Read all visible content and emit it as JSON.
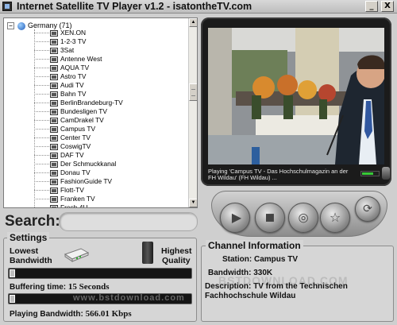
{
  "window": {
    "title": "Internet Satellite TV Player v1.2 - isatontheTV.com",
    "minimize_glyph": "_",
    "close_glyph": "X"
  },
  "tree": {
    "root_label": "Germany (71)",
    "expander": "−",
    "channels": [
      "XEN.ON",
      "1-2-3 TV",
      "3Sat",
      "Antenne West",
      "AQUA TV",
      "Astro TV",
      "Audi TV",
      "Bahn TV",
      "BerlinBrandeburg-TV",
      "Bundesligen TV",
      "CamDrakel TV",
      "Campus TV",
      "Center TV",
      "CoswigTV",
      "DAF TV",
      "Der Schmuckkanal",
      "Donau TV",
      "FashionGuide TV",
      "Flott-TV",
      "Franken TV",
      "Fresh 4U"
    ]
  },
  "player": {
    "now_playing": "Playing 'Campus TV - Das Hochschulmagazin an der",
    "now_playing_line2": "FH Wildau' (FH Wildau) ...",
    "signal_level": 0.65
  },
  "search": {
    "label": "Search:",
    "value": ""
  },
  "settings": {
    "title": "Settings",
    "lowest_label": "Lowest",
    "bandwidth_label": "Bandwidth",
    "highest_label": "Highest",
    "quality_label": "Quality",
    "bandwidth_slider_level": 0.0,
    "buffering_key": "Buffering time:",
    "buffering_value": "15 Seconds",
    "buffering_slider_level": 0.0,
    "playing_key": "Playing Bandwidth:",
    "playing_value": "566.01 Kbps"
  },
  "channel_info": {
    "title": "Channel Information",
    "station_key": "Station:",
    "station_value": "Campus TV",
    "bandwidth_key": "Bandwidth:",
    "bandwidth_value": "330K",
    "description_key": "Description:",
    "description_value": "TV from the Technischen",
    "description_value_line2": "Fachhochschule Wildau"
  },
  "watermarks": {
    "a": "www.bstdownload.com",
    "b": "BSTDOWNLOAD.COM"
  },
  "controls": {
    "play_icon": "play-icon",
    "stop_icon": "stop-icon",
    "record_icon": "record-icon",
    "favorite_icon": "star-icon",
    "refresh_icon": "refresh-icon"
  }
}
